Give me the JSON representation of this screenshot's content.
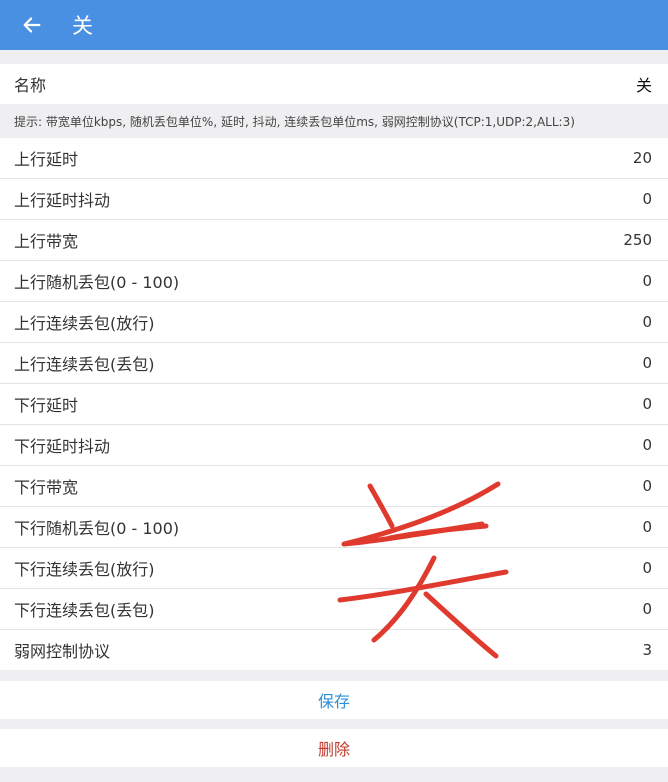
{
  "header": {
    "title": "关"
  },
  "name_field": {
    "label": "名称",
    "value": "关"
  },
  "hint": "提示: 带宽单位kbps, 随机丢包单位%, 延时, 抖动, 连续丢包单位ms, 弱网控制协议(TCP:1,UDP:2,ALL:3)",
  "settings": [
    {
      "label": "上行延时",
      "value": "20"
    },
    {
      "label": "上行延时抖动",
      "value": "0"
    },
    {
      "label": "上行带宽",
      "value": "250"
    },
    {
      "label": "上行随机丢包(0 - 100)",
      "value": "0"
    },
    {
      "label": "上行连续丢包(放行)",
      "value": "0"
    },
    {
      "label": "上行连续丢包(丢包)",
      "value": "0"
    },
    {
      "label": "下行延时",
      "value": "0"
    },
    {
      "label": "下行延时抖动",
      "value": "0"
    },
    {
      "label": "下行带宽",
      "value": "0"
    },
    {
      "label": "下行随机丢包(0 - 100)",
      "value": "0"
    },
    {
      "label": "下行连续丢包(放行)",
      "value": "0"
    },
    {
      "label": "下行连续丢包(丢包)",
      "value": "0"
    },
    {
      "label": "弱网控制协议",
      "value": "3"
    }
  ],
  "actions": {
    "save": "保存",
    "delete": "删除"
  },
  "colors": {
    "appbar": "#4a90e2",
    "save": "#2f8fd8",
    "delete": "#c0392b",
    "scribble": "#e03a2f"
  },
  "icons": {
    "back": "arrow-left-icon"
  },
  "annotation": {
    "handwritten_text": "关"
  }
}
